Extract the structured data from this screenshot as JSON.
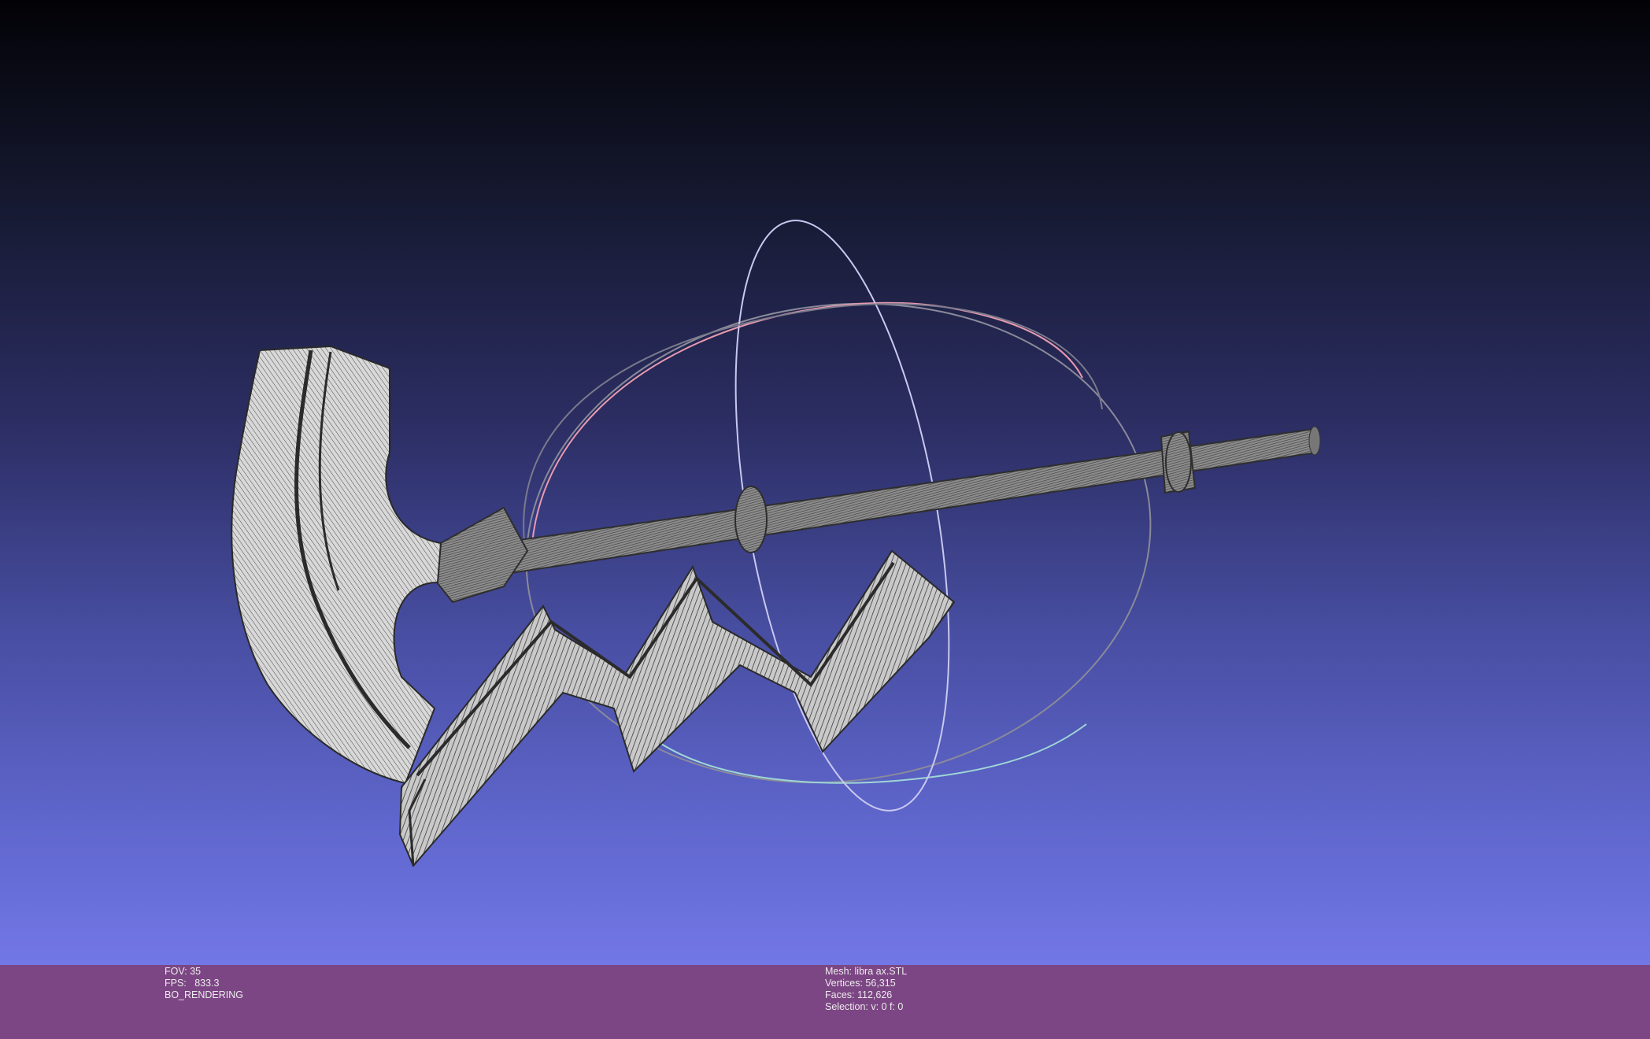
{
  "viewport": {
    "model_name": "battle-axe-wireframe",
    "trackball_colors": {
      "x_ring": "#e89ab0",
      "y_ring": "#c8c8f0",
      "z_ring": "#9fd6d6",
      "neutral_ring": "#8a8a9a"
    },
    "background_top": "#020206",
    "background_bottom": "#7277e6"
  },
  "status_left": {
    "fov_label": "FOV:",
    "fov_value": "35",
    "fps_label": "FPS:",
    "fps_value": "833.3",
    "render_mode": "BO_RENDERING"
  },
  "status_right": {
    "mesh_label": "Mesh:",
    "mesh_value": "libra ax.STL",
    "vertices_label": "Vertices:",
    "vertices_value": "56,315",
    "faces_label": "Faces:",
    "faces_value": "112,626",
    "selection_label": "Selection:",
    "selection_value": "v: 0 f: 0"
  },
  "status_bar_color": "#7c4684"
}
